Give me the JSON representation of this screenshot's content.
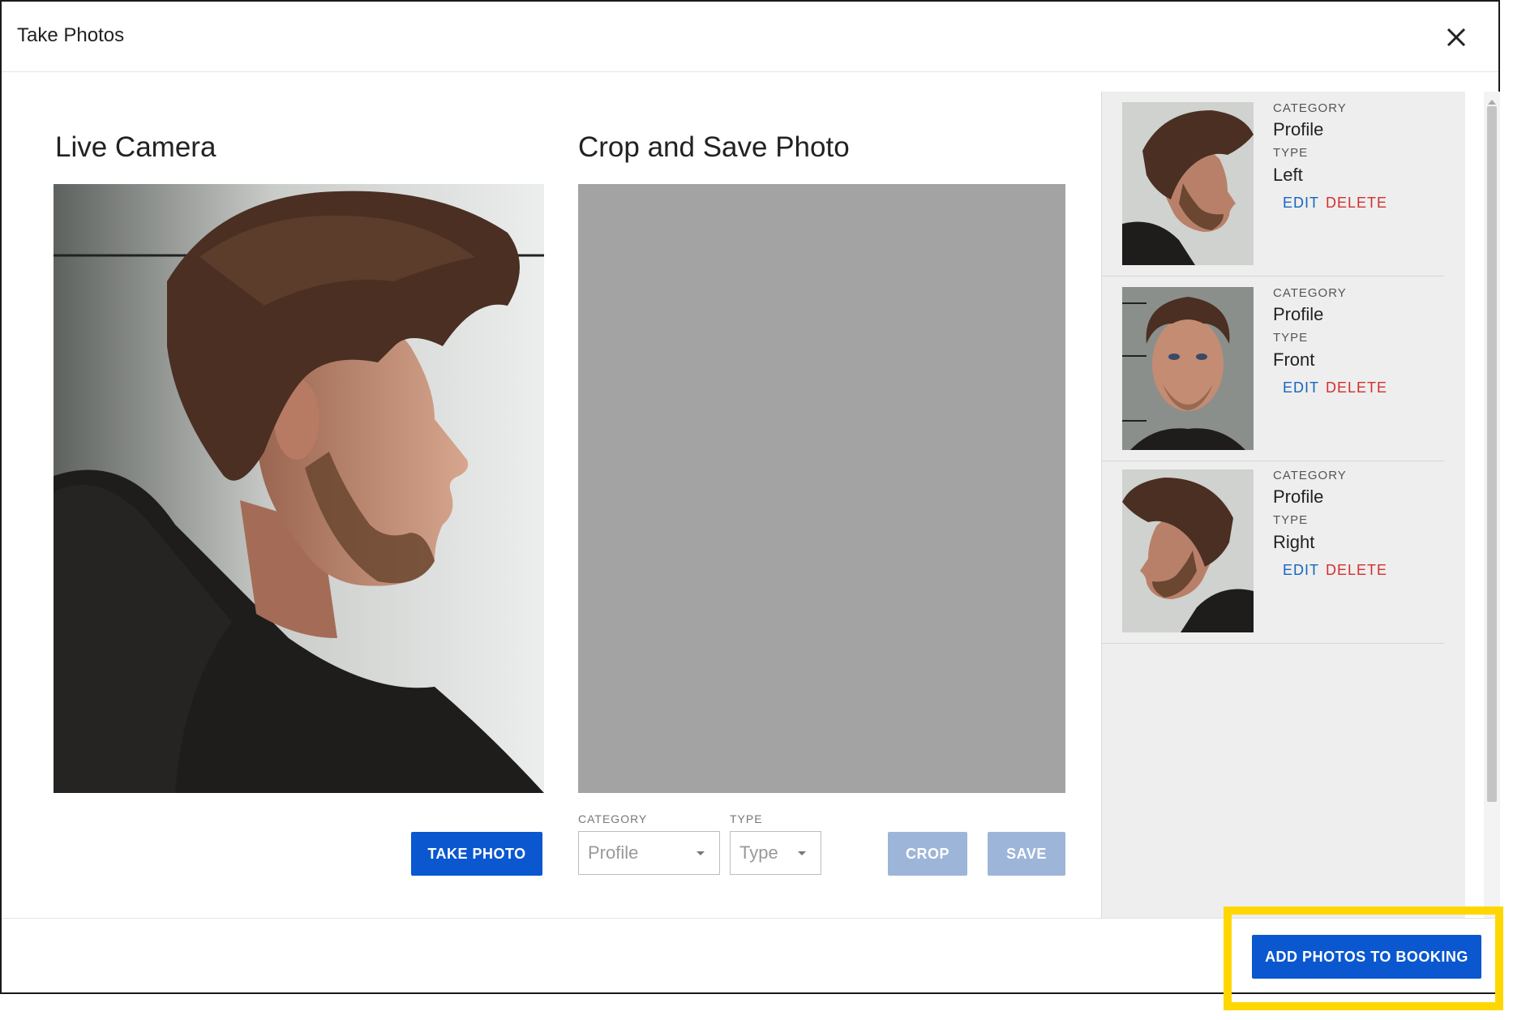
{
  "dialog": {
    "title": "Take Photos"
  },
  "live_camera": {
    "title": "Live Camera",
    "take_photo_label": "TAKE PHOTO"
  },
  "crop": {
    "title": "Crop and Save Photo",
    "category_label": "CATEGORY",
    "category_placeholder": "Profile",
    "type_label": "TYPE",
    "type_placeholder": "Type",
    "crop_label": "CROP",
    "save_label": "SAVE"
  },
  "photos": [
    {
      "category_label": "CATEGORY",
      "category": "Profile",
      "type_label": "TYPE",
      "type": "Left",
      "edit_label": "EDIT",
      "delete_label": "DELETE"
    },
    {
      "category_label": "CATEGORY",
      "category": "Profile",
      "type_label": "TYPE",
      "type": "Front",
      "edit_label": "EDIT",
      "delete_label": "DELETE"
    },
    {
      "category_label": "CATEGORY",
      "category": "Profile",
      "type_label": "TYPE",
      "type": "Right",
      "edit_label": "EDIT",
      "delete_label": "DELETE"
    }
  ],
  "footer": {
    "add_label": "ADD PHOTOS TO BOOKING"
  },
  "colors": {
    "primary": "#0a57d0",
    "disabled": "#9db5d8",
    "edit": "#1565c0",
    "delete": "#d32f2f",
    "highlight": "#ffd700"
  },
  "icons": {
    "close": "close-icon",
    "dropdown": "chevron-down-icon",
    "scroll": "scroll-up-icon"
  }
}
